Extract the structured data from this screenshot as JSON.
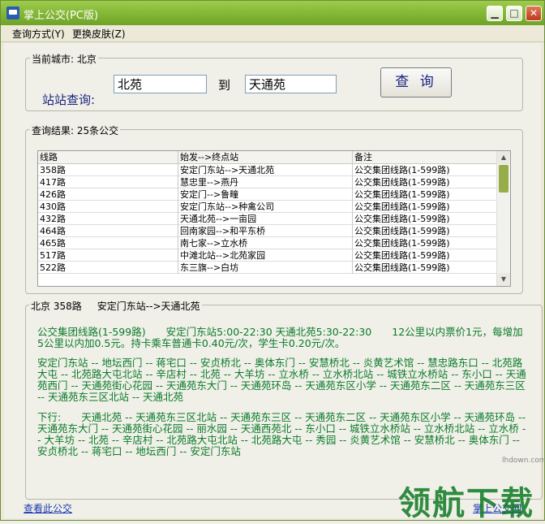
{
  "window": {
    "title": "掌上公交(PC版)",
    "buttons": {
      "minimize": "▁",
      "maximize": "□",
      "close": "✕"
    }
  },
  "menu": {
    "items": [
      "查询方式(Y)",
      "更换皮肤(Z)"
    ]
  },
  "search": {
    "group_label": "当前城市: 北京",
    "label": "站站查询:",
    "from_value": "北苑",
    "to_label": "到",
    "to_value": "天通苑",
    "query_button": "查 询"
  },
  "results": {
    "group_label": "查询结果: 25条公交",
    "columns": [
      "线路",
      "始发-->终点站",
      "备注"
    ],
    "rows": [
      [
        "358路",
        "安定门东站-->天通北苑",
        "公交集团线路(1-599路)"
      ],
      [
        "417路",
        "慧忠里-->燕丹",
        "公交集团线路(1-599路)"
      ],
      [
        "426路",
        "安定门-->鲁疃",
        "公交集团线路(1-599路)"
      ],
      [
        "430路",
        "安定门东站-->种禽公司",
        "公交集团线路(1-599路)"
      ],
      [
        "432路",
        "天通北苑-->一亩园",
        "公交集团线路(1-599路)"
      ],
      [
        "464路",
        "回南家园-->和平东桥",
        "公交集团线路(1-599路)"
      ],
      [
        "465路",
        "南七家-->立水桥",
        "公交集团线路(1-599路)"
      ],
      [
        "517路",
        "中滩北站-->北苑家园",
        "公交集团线路(1-599路)"
      ],
      [
        "522路",
        "东三旗-->白坊",
        "公交集团线路(1-599路)"
      ]
    ]
  },
  "detail": {
    "head": "北京 358路     安定门东站-->天通北苑",
    "info": "公交集团线路(1-599路)　　安定门东站5:00-22:30 天通北苑5:30-22:30　　12公里以内票价1元，每增加5公里以内加0.5元。持卡乘车普通卡0.40元/次，学生卡0.20元/次。",
    "up_route": "安定门东站 -- 地坛西门 -- 蒋宅口 -- 安贞桥北 -- 奥体东门 -- 安慧桥北 -- 炎黄艺术馆 -- 慧忠路东口 -- 北苑路大屯 -- 北苑路大屯北站 -- 辛店村 -- 北苑 -- 大羊坊 -- 立水桥 -- 立水桥北站 -- 城铁立水桥站 -- 东小口 -- 天通苑西门 -- 天通苑街心花园 -- 天通苑东大门 -- 天通苑环岛 -- 天通苑东区小学 -- 天通苑东二区 -- 天通苑东三区 -- 天通苑东三区北站 -- 天通北苑",
    "down_route": "下行:　　天通北苑 -- 天通苑东三区北站 -- 天通苑东三区 -- 天通苑东二区 -- 天通苑东区小学 -- 天通苑环岛 -- 天通苑东大门 -- 天通苑街心花园 -- 丽水园 -- 天通西苑北 -- 东小口 -- 城铁立水桥站 -- 立水桥北站 -- 立水桥 -- 大羊坊 -- 北苑 -- 辛店村 -- 北苑路大屯北站 -- 北苑路大屯 -- 秀园 -- 炎黄艺术馆 -- 安慧桥北 -- 奥体东门 -- 安贞桥北 -- 蒋宅口 -- 地坛西门 -- 安定门东站"
  },
  "footer": {
    "left_link": "查看此公交",
    "right_link": "掌上公交网"
  },
  "watermark": {
    "text": "领航下载",
    "url": "lhdown.com"
  }
}
